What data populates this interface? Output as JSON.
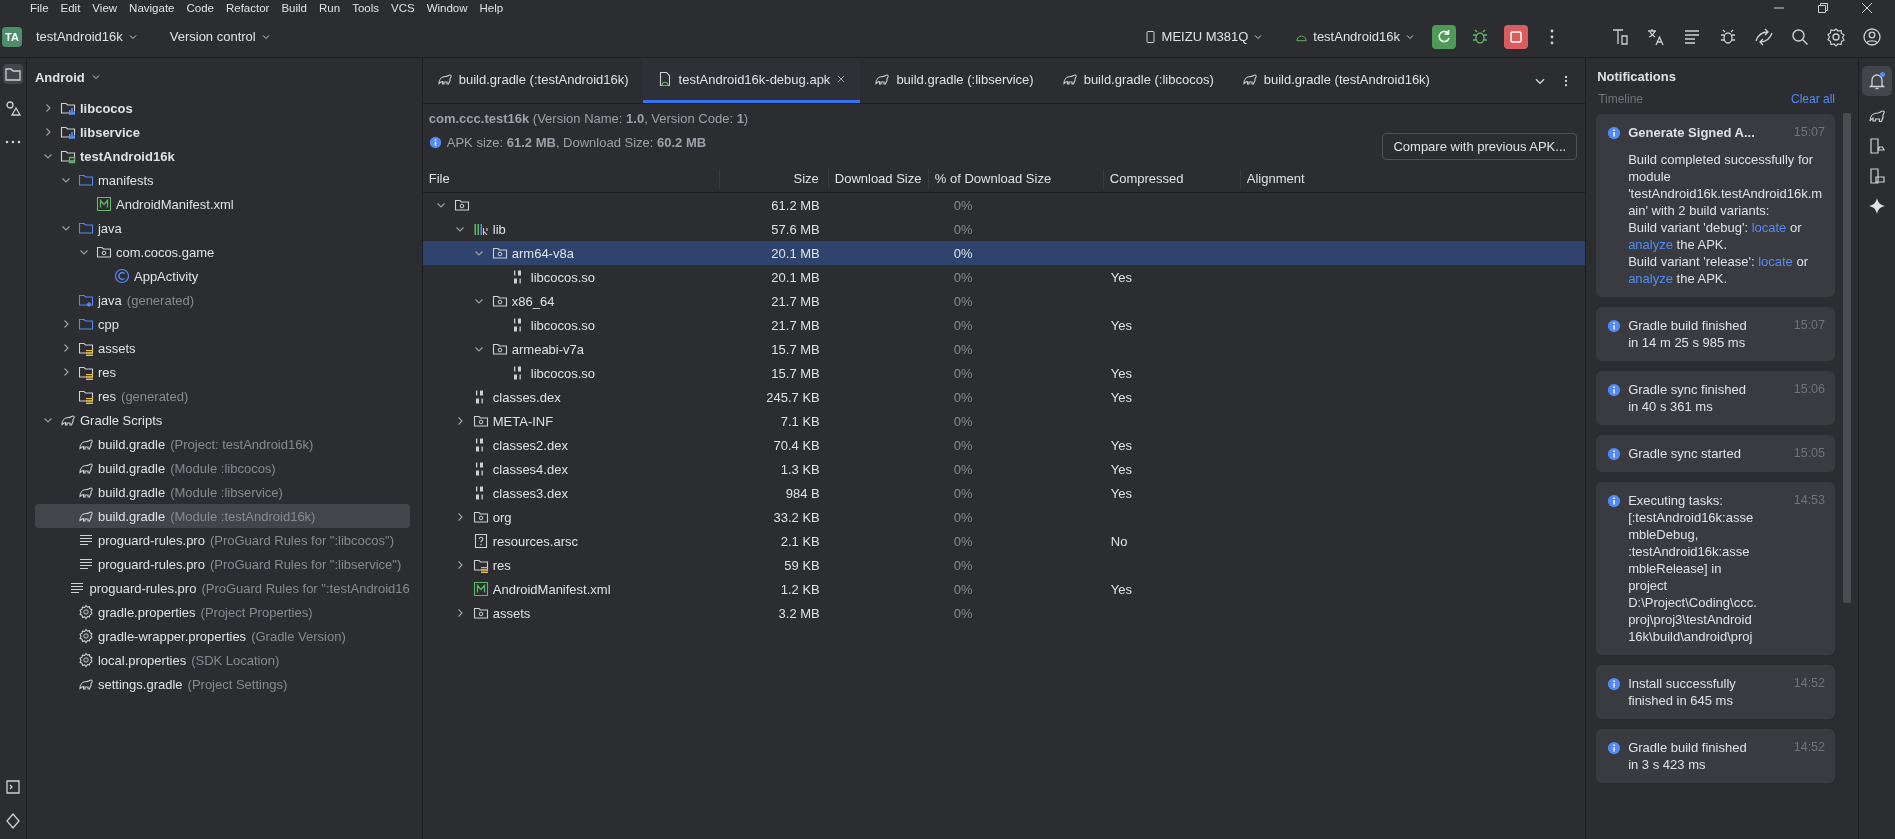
{
  "menu": [
    "File",
    "Edit",
    "View",
    "Navigate",
    "Code",
    "Refactor",
    "Build",
    "Run",
    "Tools",
    "VCS",
    "Window",
    "Help"
  ],
  "toolbar": {
    "project_badge": "TA",
    "project": "testAndroid16k",
    "vcs": "Version control",
    "device": "MEIZU M381Q",
    "run_config": "testAndroid16k"
  },
  "project": {
    "view": "Android",
    "items": [
      {
        "label": "libcocos",
        "kind": "module",
        "bold": true,
        "expanded": false,
        "selected": false
      },
      {
        "label": "libservice",
        "kind": "module",
        "bold": true,
        "expanded": false,
        "selected": false
      },
      {
        "label": "testAndroid16k",
        "kind": "app-module",
        "bold": true,
        "expanded": true,
        "selected": false,
        "children": [
          {
            "label": "manifests",
            "kind": "folder",
            "expanded": true,
            "selected": false,
            "children": [
              {
                "label": "AndroidManifest.xml",
                "kind": "manifest",
                "selected": false
              }
            ]
          },
          {
            "label": "java",
            "kind": "folder",
            "expanded": true,
            "selected": false,
            "children": [
              {
                "label": "com.cocos.game",
                "kind": "package",
                "expanded": true,
                "selected": false,
                "children": [
                  {
                    "label": "AppActivity",
                    "kind": "class",
                    "selected": false
                  }
                ]
              }
            ]
          },
          {
            "label": "java",
            "note": "(generated)",
            "kind": "gen-folder",
            "selected": false
          },
          {
            "label": "cpp",
            "kind": "folder",
            "expanded": false,
            "selected": false
          },
          {
            "label": "assets",
            "kind": "res-folder",
            "expanded": false,
            "selected": false
          },
          {
            "label": "res",
            "kind": "res-folder",
            "expanded": false,
            "selected": false
          },
          {
            "label": "res",
            "note": "(generated)",
            "kind": "res-folder",
            "selected": false
          }
        ]
      },
      {
        "label": "Gradle Scripts",
        "kind": "gradle",
        "expanded": true,
        "selected": false,
        "children": [
          {
            "label": "build.gradle",
            "note": "(Project: testAndroid16k)",
            "kind": "gradle",
            "selected": false
          },
          {
            "label": "build.gradle",
            "note": "(Module :libcocos)",
            "kind": "gradle",
            "selected": false
          },
          {
            "label": "build.gradle",
            "note": "(Module :libservice)",
            "kind": "gradle",
            "selected": false
          },
          {
            "label": "build.gradle",
            "note": "(Module :testAndroid16k)",
            "kind": "gradle",
            "selected": true
          },
          {
            "label": "proguard-rules.pro",
            "note": "(ProGuard Rules for \":libcocos\")",
            "kind": "lines",
            "selected": false
          },
          {
            "label": "proguard-rules.pro",
            "note": "(ProGuard Rules for \":libservice\")",
            "kind": "lines",
            "selected": false
          },
          {
            "label": "proguard-rules.pro",
            "note": "(ProGuard Rules for \":testAndroid16",
            "kind": "lines",
            "selected": false
          },
          {
            "label": "gradle.properties",
            "note": "(Project Properties)",
            "kind": "gear",
            "selected": false
          },
          {
            "label": "gradle-wrapper.properties",
            "note": "(Gradle Version)",
            "kind": "gear",
            "selected": false
          },
          {
            "label": "local.properties",
            "note": "(SDK Location)",
            "kind": "gear",
            "selected": false
          },
          {
            "label": "settings.gradle",
            "note": "(Project Settings)",
            "kind": "gradle",
            "selected": false
          }
        ]
      }
    ]
  },
  "tabs": [
    {
      "label": "build.gradle (:testAndroid16k)",
      "kind": "gradle",
      "selected": false
    },
    {
      "label": "testAndroid16k-debug.apk",
      "kind": "apk",
      "selected": true
    },
    {
      "label": "build.gradle (:libservice)",
      "kind": "gradle",
      "selected": false
    },
    {
      "label": "build.gradle (:libcocos)",
      "kind": "gradle",
      "selected": false
    },
    {
      "label": "build.gradle (testAndroid16k)",
      "kind": "gradle",
      "selected": false
    }
  ],
  "apk": {
    "package_line": "**com.ccc.test16k** (Version Name: **1.0**, Version Code: **1**)",
    "size_line": "APK size: **61.2 MB**, Download Size: **60.2 MB**",
    "compare_button": "Compare with previous APK..."
  },
  "table": {
    "columns": [
      "File",
      "Size",
      "Download Size",
      "% of Download Size",
      "Compressed",
      "Alignment"
    ],
    "rows": [
      {
        "kind": "package",
        "size": "61.2 MB",
        "percent": "0%",
        "expanded": true,
        "selected": false,
        "children": [
          {
            "name": "lib",
            "kind": "library",
            "size": "57.6 MB",
            "percent": "0%",
            "expanded": true,
            "selected": false,
            "children": [
              {
                "name": "arm64-v8a",
                "kind": "package",
                "size": "20.1 MB",
                "percent": "0%",
                "expanded": true,
                "selected": true,
                "children": [
                  {
                    "name": "libcocos.so",
                    "kind": "binary",
                    "size": "20.1 MB",
                    "percent": "0%",
                    "compressed": "Yes",
                    "selected": false
                  }
                ]
              },
              {
                "name": "x86_64",
                "kind": "package",
                "size": "21.7 MB",
                "percent": "0%",
                "expanded": true,
                "selected": false,
                "children": [
                  {
                    "name": "libcocos.so",
                    "kind": "binary",
                    "size": "21.7 MB",
                    "percent": "0%",
                    "compressed": "Yes",
                    "selected": false
                  }
                ]
              },
              {
                "name": "armeabi-v7a",
                "kind": "package",
                "size": "15.7 MB",
                "percent": "0%",
                "expanded": true,
                "selected": false,
                "children": [
                  {
                    "name": "libcocos.so",
                    "kind": "binary",
                    "size": "15.7 MB",
                    "percent": "0%",
                    "compressed": "Yes",
                    "selected": false
                  }
                ]
              }
            ]
          },
          {
            "name": "classes.dex",
            "kind": "binary",
            "size": "245.7 KB",
            "percent": "0%",
            "compressed": "Yes",
            "selected": false
          },
          {
            "name": "META-INF",
            "kind": "package",
            "size": "7.1 KB",
            "percent": "0%",
            "expanded": false,
            "selected": false
          },
          {
            "name": "classes2.dex",
            "kind": "binary",
            "size": "70.4 KB",
            "percent": "0%",
            "compressed": "Yes",
            "selected": false
          },
          {
            "name": "classes4.dex",
            "kind": "binary",
            "size": "1.3 KB",
            "percent": "0%",
            "compressed": "Yes",
            "selected": false
          },
          {
            "name": "classes3.dex",
            "kind": "binary",
            "size": "984 B",
            "percent": "0%",
            "compressed": "Yes",
            "selected": false
          },
          {
            "name": "org",
            "kind": "package",
            "size": "33.2 KB",
            "percent": "0%",
            "expanded": false,
            "selected": false
          },
          {
            "name": "resources.arsc",
            "kind": "unknown",
            "size": "2.1 KB",
            "percent": "0%",
            "compressed": "No",
            "selected": false
          },
          {
            "name": "res",
            "kind": "res-folder",
            "size": "59 KB",
            "percent": "0%",
            "expanded": false,
            "selected": false
          },
          {
            "name": "AndroidManifest.xml",
            "kind": "manifest",
            "size": "1.2 KB",
            "percent": "0%",
            "compressed": "Yes",
            "selected": false
          },
          {
            "name": "assets",
            "kind": "package",
            "size": "3.2 MB",
            "percent": "0%",
            "expanded": false,
            "selected": false
          }
        ]
      }
    ]
  },
  "notifications": {
    "title": "Notifications",
    "section": "Timeline",
    "clear": "Clear all",
    "items": [
      {
        "kind": "detailed",
        "title": "Generate Signed A...",
        "time": "15:07",
        "body": [
          [
            {
              "text": "Build completed successfully for module 'testAndroid16k.testAndroid16k.main' with 2 build variants:",
              "link": false
            }
          ],
          [
            {
              "text": "Build variant 'debug': ",
              "link": false
            },
            {
              "text": "locate",
              "link": true
            },
            {
              "text": " or ",
              "link": false
            },
            {
              "text": "analyze",
              "link": true
            },
            {
              "text": " the APK.",
              "link": false
            }
          ],
          [
            {
              "text": "Build variant 'release': ",
              "link": false
            },
            {
              "text": "locate",
              "link": true
            },
            {
              "text": " or ",
              "link": false
            },
            {
              "text": "analyze",
              "link": true
            },
            {
              "text": " the APK.",
              "link": false
            }
          ]
        ]
      },
      {
        "kind": "simple",
        "title": "Gradle build finished in 14 m 25 s 985 ms",
        "time": "15:07"
      },
      {
        "kind": "simple",
        "title": "Gradle sync finished in 40 s 361 ms",
        "time": "15:06"
      },
      {
        "kind": "simple",
        "title": "Gradle sync started",
        "time": "15:05"
      },
      {
        "kind": "simple",
        "title": "Executing tasks: [:testAndroid16k:assembleDebug, :testAndroid16k:assembleRelease] in project D:\\Project\\Coding\\ccc.proj\\proj3\\testAndroid16k\\build\\android\\proj",
        "time": "14:53"
      },
      {
        "kind": "simple",
        "title": "Install successfully finished in 645 ms",
        "time": "14:52"
      },
      {
        "kind": "simple",
        "title": "Gradle build finished in 3 s 423 ms",
        "time": "14:52"
      }
    ]
  }
}
